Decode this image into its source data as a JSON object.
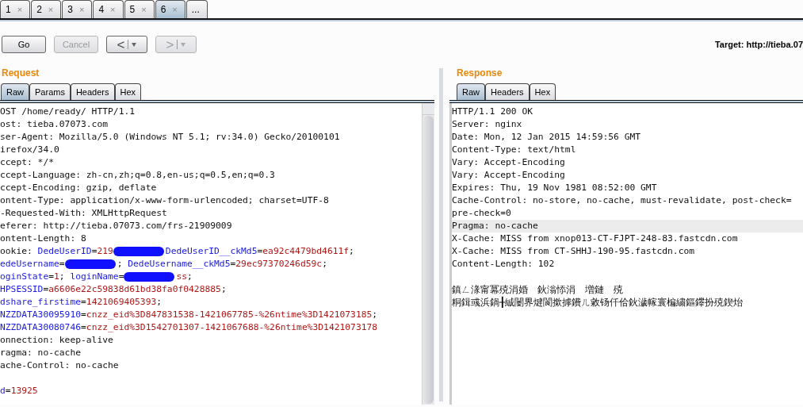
{
  "tabs": [
    {
      "label": "1",
      "close": "×",
      "selected": false
    },
    {
      "label": "2",
      "close": "×",
      "selected": false
    },
    {
      "label": "3",
      "close": "×",
      "selected": false
    },
    {
      "label": "4",
      "close": "×",
      "selected": false
    },
    {
      "label": "5",
      "close": "×",
      "selected": false
    },
    {
      "label": "6",
      "close": "×",
      "selected": true
    },
    {
      "label": "...",
      "selected": false
    }
  ],
  "toolbar": {
    "buttons": [
      {
        "kind": "text",
        "label": "Go",
        "disabled": false
      },
      {
        "kind": "text",
        "label": "Cancel",
        "disabled": true
      },
      {
        "kind": "nav",
        "label": "<",
        "disabled": false
      },
      {
        "kind": "nav",
        "label": ">",
        "disabled": true
      }
    ],
    "target": "Target: http://tieba.07"
  },
  "request": {
    "title": "Request",
    "tabs": [
      {
        "label": "Raw",
        "selected": true
      },
      {
        "label": "Params",
        "selected": false
      },
      {
        "label": "Headers",
        "selected": false
      },
      {
        "label": "Hex",
        "selected": false
      }
    ],
    "lines": [
      [
        {
          "kind": "plain",
          "text": "OST /home/ready/ HTTP/1.1"
        }
      ],
      [
        {
          "kind": "plain",
          "text": "ost: tieba.07073.com"
        }
      ],
      [
        {
          "kind": "plain",
          "text": "ser-Agent: Mozilla/5.0 (Windows NT 5.1; rv:34.0) Gecko/20100101"
        }
      ],
      [
        {
          "kind": "plain",
          "text": "irefox/34.0"
        }
      ],
      [
        {
          "kind": "plain",
          "text": "ccept: */*"
        }
      ],
      [
        {
          "kind": "plain",
          "text": "ccept-Language: zh-cn,zh;q=0.8,en-us;q=0.5,en;q=0.3"
        }
      ],
      [
        {
          "kind": "plain",
          "text": "ccept-Encoding: gzip, deflate"
        }
      ],
      [
        {
          "kind": "plain",
          "text": "ontent-Type: application/x-www-form-urlencoded; charset=UTF-8"
        }
      ],
      [
        {
          "kind": "plain",
          "text": "-Requested-With: XMLHttpRequest"
        }
      ],
      [
        {
          "kind": "plain",
          "text": "eferer: http://tieba.07073.com/frs-21909009"
        }
      ],
      [
        {
          "kind": "plain",
          "text": "ontent-Length: 8"
        }
      ],
      [
        {
          "kind": "plain",
          "text": "ookie: "
        },
        {
          "kind": "name",
          "text": "DedeUserID"
        },
        {
          "kind": "plain",
          "text": "="
        },
        {
          "kind": "value",
          "text": "219"
        },
        {
          "kind": "scribble"
        },
        {
          "kind": "name",
          "text": "DedeUserID__ckMd5"
        },
        {
          "kind": "plain",
          "text": "="
        },
        {
          "kind": "value",
          "text": "ea92c4479bd4611f"
        },
        {
          "kind": "plain",
          "text": ";"
        }
      ],
      [
        {
          "kind": "name",
          "text": "edeUsername"
        },
        {
          "kind": "plain",
          "text": "="
        },
        {
          "kind": "scribble"
        },
        {
          "kind": "plain",
          "text": "; "
        },
        {
          "kind": "name",
          "text": "DedeUsername__ckMd5"
        },
        {
          "kind": "plain",
          "text": "="
        },
        {
          "kind": "value",
          "text": "29ec97370246d59c"
        },
        {
          "kind": "plain",
          "text": ";"
        }
      ],
      [
        {
          "kind": "name",
          "text": "oginState"
        },
        {
          "kind": "plain",
          "text": "="
        },
        {
          "kind": "value",
          "text": "1"
        },
        {
          "kind": "plain",
          "text": "; "
        },
        {
          "kind": "name",
          "text": "loginName"
        },
        {
          "kind": "plain",
          "text": "="
        },
        {
          "kind": "scribble"
        },
        {
          "kind": "value",
          "text": "ss"
        },
        {
          "kind": "plain",
          "text": ";"
        }
      ],
      [
        {
          "kind": "name",
          "text": "HPSESSID"
        },
        {
          "kind": "plain",
          "text": "="
        },
        {
          "kind": "value",
          "text": "a6606e22c59838d61bd38fa0f0428885"
        },
        {
          "kind": "plain",
          "text": ";"
        }
      ],
      [
        {
          "kind": "name",
          "text": "dshare_firstime"
        },
        {
          "kind": "plain",
          "text": "="
        },
        {
          "kind": "value",
          "text": "1421069405393"
        },
        {
          "kind": "plain",
          "text": ";"
        }
      ],
      [
        {
          "kind": "name",
          "text": "NZZDATA30095910"
        },
        {
          "kind": "plain",
          "text": "="
        },
        {
          "kind": "value",
          "text": "cnzz_eid%3D847831538-1421067785-%26ntime%3D1421073185"
        },
        {
          "kind": "plain",
          "text": ";"
        }
      ],
      [
        {
          "kind": "name",
          "text": "NZZDATA30080746"
        },
        {
          "kind": "plain",
          "text": "="
        },
        {
          "kind": "value",
          "text": "cnzz_eid%3D1542701307-1421067688-%26ntime%3D1421073178"
        }
      ],
      [
        {
          "kind": "plain",
          "text": "onnection: keep-alive"
        }
      ],
      [
        {
          "kind": "plain",
          "text": "ragma: no-cache"
        }
      ],
      [
        {
          "kind": "plain",
          "text": "ache-Control: no-cache"
        }
      ]
    ],
    "body": [
      [
        {
          "kind": "name",
          "text": "d"
        },
        {
          "kind": "plain",
          "text": "="
        },
        {
          "kind": "value",
          "text": "13925"
        }
      ]
    ]
  },
  "response": {
    "title": "Response",
    "tabs": [
      {
        "label": "Raw",
        "selected": true
      },
      {
        "label": "Headers",
        "selected": false
      },
      {
        "label": "Hex",
        "selected": false
      }
    ],
    "lines": [
      {
        "text": "HTTP/1.1 200 OK",
        "highlighted": false
      },
      {
        "text": "Server: nginx",
        "highlighted": false
      },
      {
        "text": "Date: Mon, 12 Jan 2015 14:59:56 GMT",
        "highlighted": false
      },
      {
        "text": "Content-Type: text/html",
        "highlighted": false
      },
      {
        "text": "Vary: Accept-Encoding",
        "highlighted": false
      },
      {
        "text": "Vary: Accept-Encoding",
        "highlighted": false
      },
      {
        "text": "Expires: Thu, 19 Nov 1981 08:52:00 GMT",
        "highlighted": false
      },
      {
        "text": "Cache-Control: no-store, no-cache, must-revalidate, post-check=",
        "highlighted": false
      },
      {
        "text": "pre-check=0",
        "highlighted": false
      },
      {
        "text": "Pragma: no-cache",
        "highlighted": true
      },
      {
        "text": "X-Cache: MISS from xnop013-CT-FJPT-248-83.fastcdn.com",
        "highlighted": false
      },
      {
        "text": "X-Cache: MISS from CT-SHHJ-190-95.fastcdn.com",
        "highlighted": false
      },
      {
        "text": "Content-Length: 102",
        "highlighted": false
      }
    ],
    "body": [
      {
        "text": "鎮ㄥ湪甯冪殑涓婚　鈥滃悿涓　増鏈　殑",
        "highlighted": false
      },
      {
        "text": "粡鍓彧浜鍋╂絾闄界煡閬撳摢鐨ㄦ敹钖仟佮鈥濊幏寰楄繍鏂鑻扮殑鍥炲",
        "highlighted": false
      }
    ]
  }
}
